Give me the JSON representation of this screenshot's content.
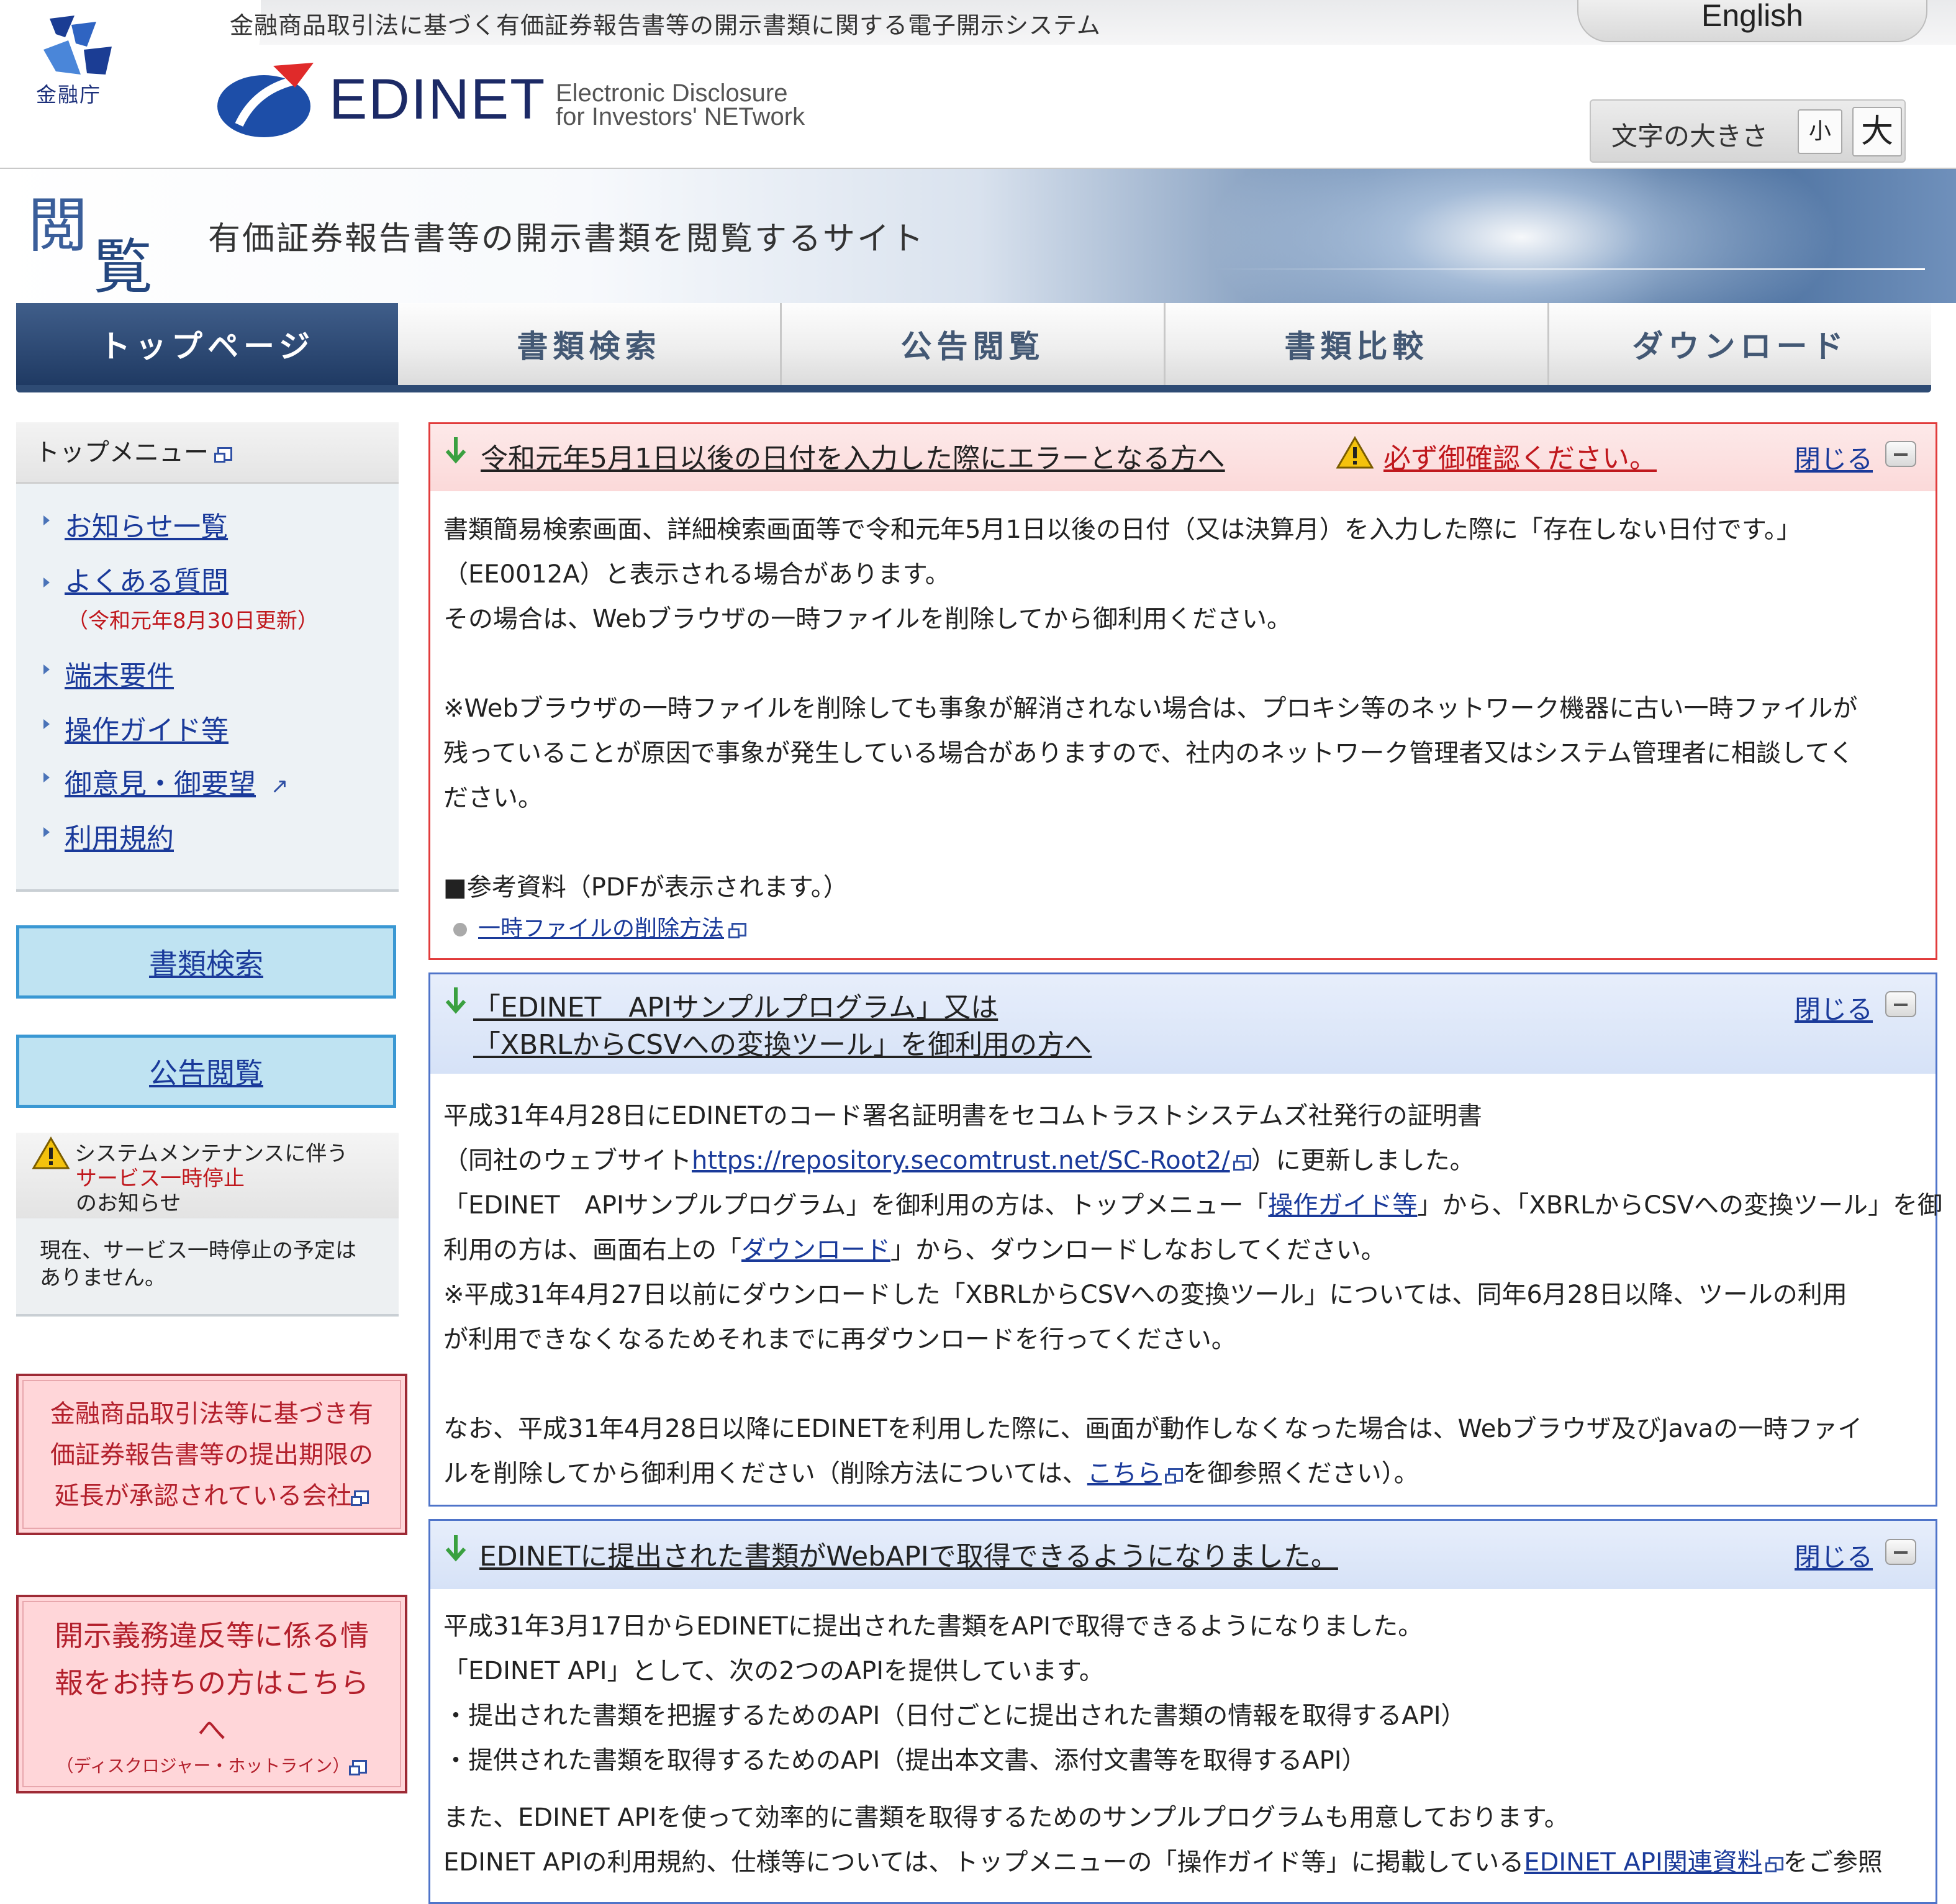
{
  "header": {
    "fsa_name": "金融庁",
    "system_description": "金融商品取引法に基づく有価証券報告書等の開示書類に関する電子開示システム",
    "logo_word": "EDINET",
    "logo_sub1": "Electronic Disclosure",
    "logo_sub2": "for Investors' NETwork",
    "english_link": "English",
    "font_size_label": "文字の大きさ",
    "font_small": "小",
    "font_large": "大"
  },
  "banner": {
    "kanji1": "閲",
    "kanji2": "覧",
    "tagline": "有価証券報告書等の開示書類を閲覧するサイト"
  },
  "nav": {
    "tabs": [
      {
        "label": "トップページ",
        "active": true
      },
      {
        "label": "書類検索",
        "active": false
      },
      {
        "label": "公告閲覧",
        "active": false
      },
      {
        "label": "書類比較",
        "active": false
      },
      {
        "label": "ダウンロード",
        "active": false
      }
    ]
  },
  "sidebar": {
    "topmenu_title": "トップメニュー",
    "items": [
      {
        "label": "お知らせ一覧"
      },
      {
        "label": "よくある質問"
      },
      {
        "label": "端末要件"
      },
      {
        "label": "操作ガイド等"
      },
      {
        "label": "御意見・御要望"
      },
      {
        "label": "利用規約"
      }
    ],
    "faq_note": "（令和元年8月30日更新）",
    "search_button": "書類検索",
    "announce_button": "公告閲覧",
    "maintenance": {
      "line1": "システムメンテナンスに伴う",
      "line2": "サービス一時停止",
      "line3": "のお知らせ",
      "body": "現在、サービス一時停止の予定はありません。"
    },
    "pink1": {
      "line1": "金融商品取引法等に基づき有",
      "line2": "価証券報告書等の提出期限の",
      "line3": "延長が承認されている会社"
    },
    "pink2": {
      "line1": "開示義務違反等に係る情",
      "line2": "報をお持ちの方はこちら",
      "line3": "へ",
      "small": "（ディスクロジャー・ホットライン）"
    }
  },
  "notices": {
    "close_label": "閉じる",
    "n1": {
      "title": "令和元年5月1日以後の日付を入力した際にエラーとなる方へ",
      "warning": "必ず御確認ください。",
      "lines": [
        "書類簡易検索画面、詳細検索画面等で令和元年5月1日以後の日付（又は決算月）を入力した際に「存在しない日付です。」",
        "（EE0012A）と表示される場合があります。",
        "その場合は、Webブラウザの一時ファイルを削除してから御利用ください。",
        "※Webブラウザの一時ファイルを削除しても事象が解消されない場合は、プロキシ等のネットワーク機器に古い一時ファイルが",
        "残っていることが原因で事象が発生している場合がありますので、社内のネットワーク管理者又はシステム管理者に相談してく",
        "ださい。",
        "■参考資料（PDFが表示されます。）"
      ],
      "link": "一時ファイルの削除方法"
    },
    "n2": {
      "title1": "「EDINET　APIサンプルプログラム」又は",
      "title2": "「XBRLからCSVへの変換ツール」を御利用の方へ",
      "line1": "平成31年4月28日にEDINETのコード署名証明書をセコムトラストシステムズ社発行の証明書",
      "line2_pre": "（同社のウェブサイト",
      "line2_link": "https://repository.secomtrust.net/SC-Root2/",
      "line2_post": "）に更新しました。",
      "line3_pre": "「EDINET　APIサンプルプログラム」を御利用の方は、トップメニュー「",
      "line3_link": "操作ガイド等",
      "line3_post": "」から、「XBRLからCSVへの変換ツール」を御",
      "line4_pre": "利用の方は、画面右上の「",
      "line4_link": "ダウンロード",
      "line4_post": "」から、ダウンロードしなおしてください。",
      "line5": "※平成31年4月27日以前にダウンロードした「XBRLからCSVへの変換ツール」については、同年6月28日以降、ツールの利用",
      "line6": "が利用できなくなるためそれまでに再ダウンロードを行ってください。",
      "line7": "なお、平成31年4月28日以降にEDINETを利用した際に、画面が動作しなくなった場合は、Webブラウザ及びJavaの一時ファイ",
      "line8_pre": "ルを削除してから御利用ください（削除方法については、",
      "line8_link": "こちら",
      "line8_post": "を御参照ください）。"
    },
    "n3": {
      "title": "EDINETに提出された書類がWebAPIで取得できるようになりました。",
      "line1": "平成31年3月17日からEDINETに提出された書類をAPIで取得できるようになりました。",
      "line2": "「EDINET API」として、次の2つのAPIを提供しています。",
      "line3": "・提出された書類を把握するためのAPI（日付ごとに提出された書類の情報を取得するAPI）",
      "line4": "・提供された書類を取得するためのAPI（提出本文書、添付文書等を取得するAPI）",
      "line5": "また、EDINET APIを使って効率的に書類を取得するためのサンプルプログラムも用意しております。",
      "line6_pre": "EDINET APIの利用規約、仕様等については、トップメニューの「操作ガイド等」に掲載している",
      "line6_link": "EDINET API関連資料",
      "line6_post": "をご参照"
    }
  },
  "colors": {
    "nav_active": "#1f3a63",
    "notice_red": "#e13b3b",
    "notice_blue": "#4f74c9",
    "link": "#1a3a9a",
    "alert_text": "#c0181d"
  }
}
